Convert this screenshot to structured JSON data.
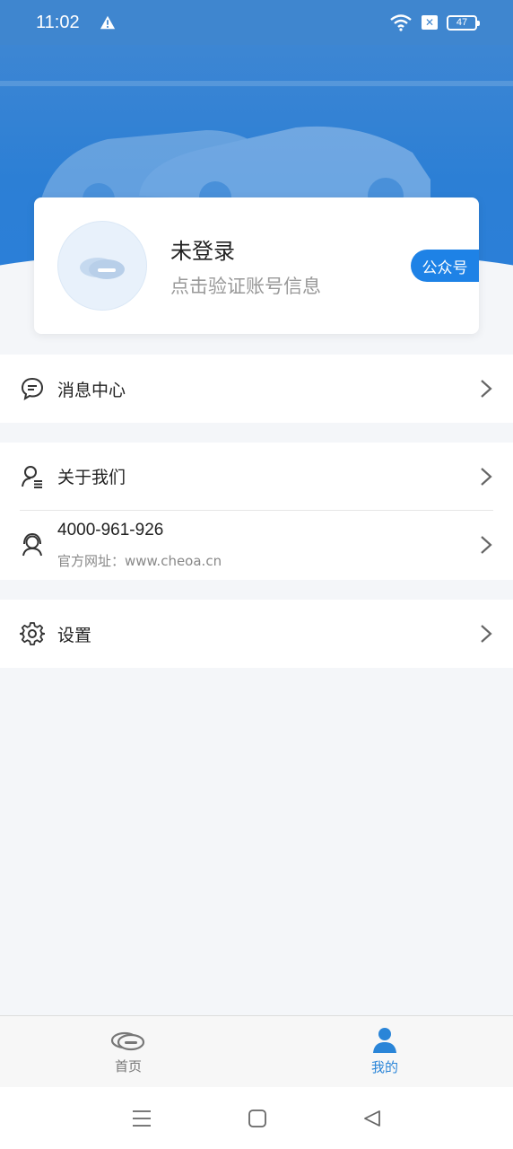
{
  "status_bar": {
    "time": "11:02",
    "battery": "47"
  },
  "profile": {
    "name": "未登录",
    "subtitle": "点击验证账号信息",
    "gzh_label": "公众号"
  },
  "menu": {
    "messages": "消息中心",
    "about": "关于我们",
    "phone": "4000-961-926",
    "website": "官方网址：www.cheoa.cn",
    "settings": "设置"
  },
  "tabs": [
    {
      "label": "首页",
      "icon": "car-icon"
    },
    {
      "label": "我的",
      "icon": "user-icon"
    }
  ],
  "colors": {
    "accent": "#2a85d8",
    "hero": "#2c7fd5",
    "badge": "#1e82e6"
  }
}
